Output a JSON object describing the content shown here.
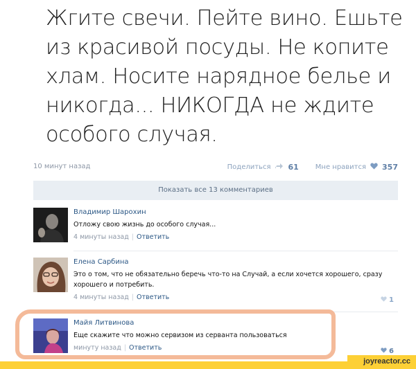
{
  "post": {
    "text": "Жгите свечи. Пейте вино. Ешьте\nиз красивой посуды. Не копите\nхлам. Носите нарядное белье и\nникогда... НИКОГДА не ждите\nособого случая.",
    "time": "10 минут назад",
    "share_label": "Поделиться",
    "share_count": "61",
    "like_label": "Мне нравится",
    "like_count": "357"
  },
  "show_all_comments": "Показать все 13 комментариев",
  "comments": [
    {
      "author": "Владимир Шарохин",
      "text": "Отложу свою жизнь до особого случая...",
      "time": "4 минуты назад",
      "reply": "Ответить",
      "likes": ""
    },
    {
      "author": "Елена Сарбина",
      "text": "Это о том, что не обязательно беречь что-то на Случай, а если хочется хорошего, сразу хорошего и потребить.",
      "time": "4 минуты назад",
      "reply": "Ответить",
      "likes": "1"
    },
    {
      "author": "Майя Литвинова",
      "text": "Еще скажите что можно сервизом из серванта пользоваться",
      "time": "минуту назад",
      "reply": "Ответить",
      "likes": "6"
    }
  ],
  "watermark": "joyreactor.cc",
  "colors": {
    "link": "#2b5785",
    "meta": "#8d97a6",
    "show_all_bg": "#e9eef3",
    "highlight": "#f3b28e",
    "footer": "#fdd036"
  },
  "icons": [
    "share-icon",
    "heart-icon"
  ]
}
